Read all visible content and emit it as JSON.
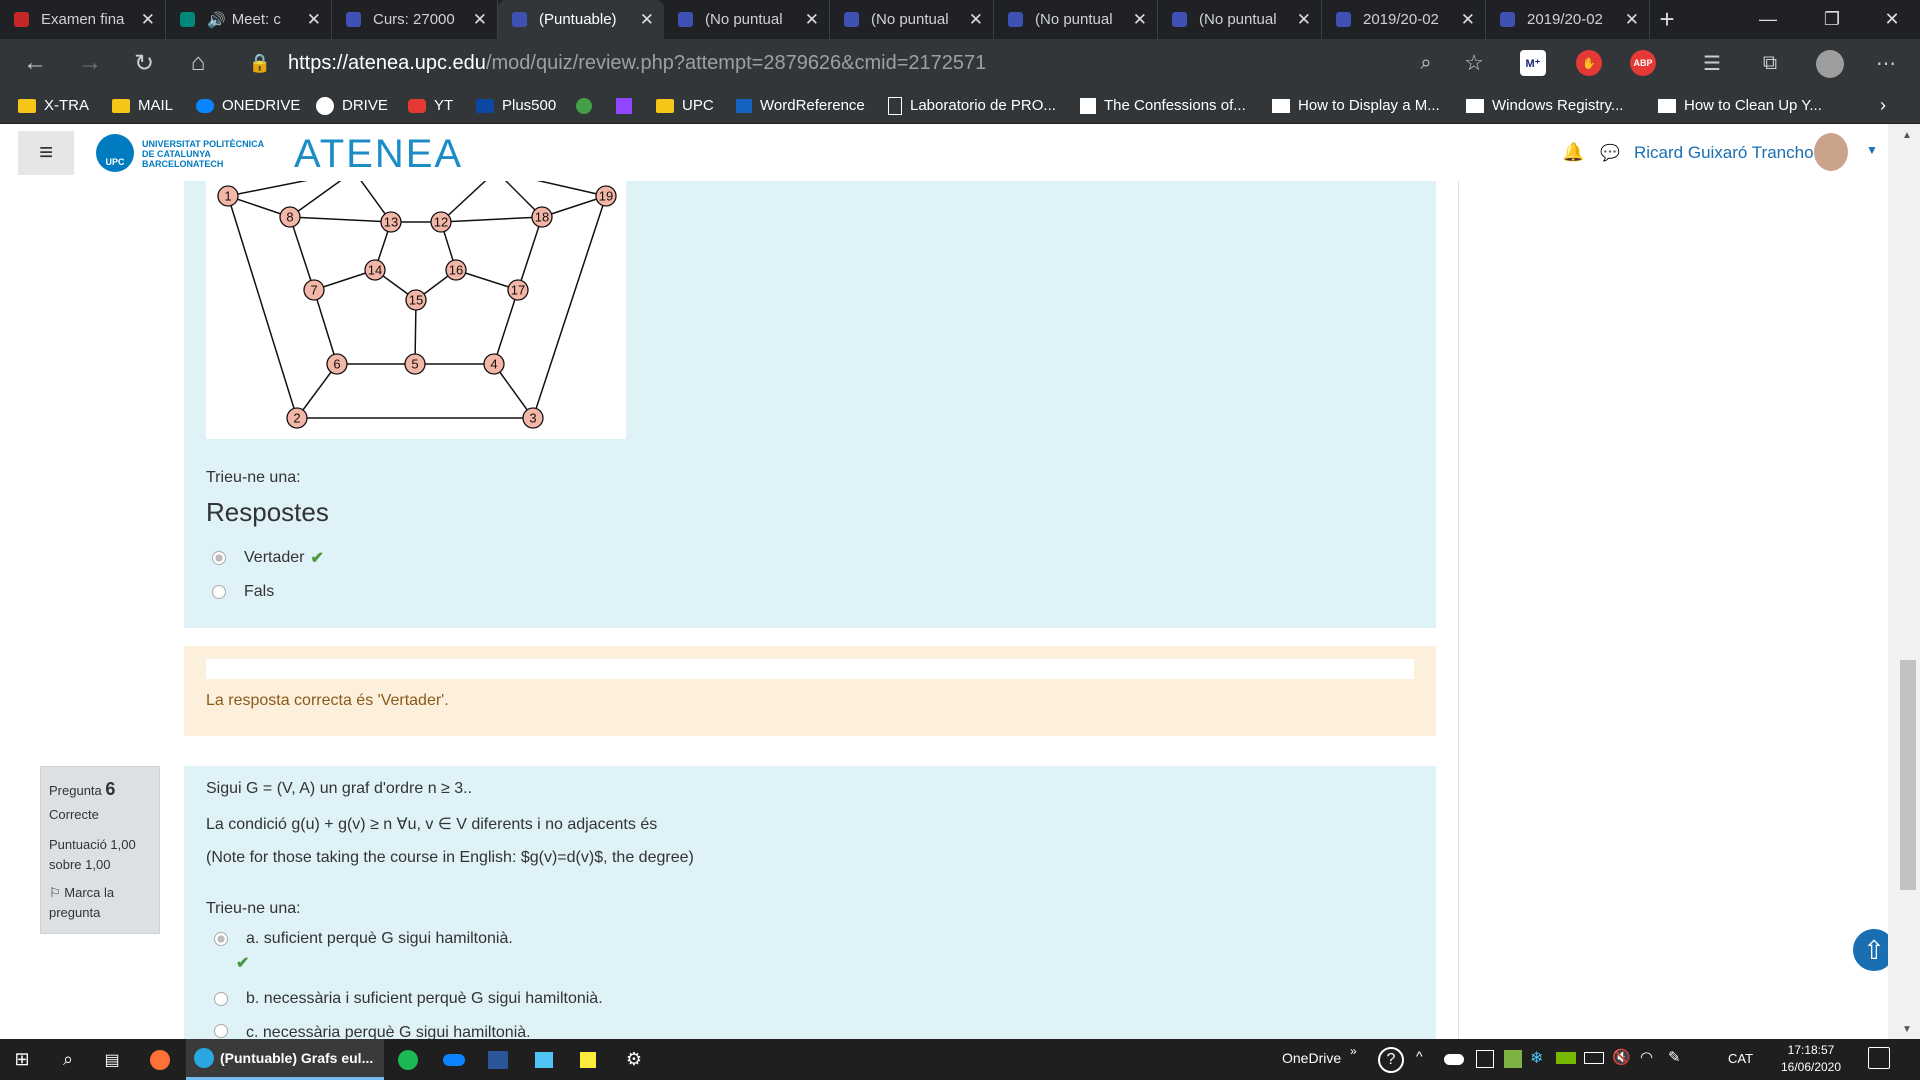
{
  "tabs": [
    {
      "title": "Examen fina",
      "icon": "flag-icon"
    },
    {
      "title": "Meet: c",
      "icon": "meet-icon"
    },
    {
      "title": "Curs: 27000",
      "icon": "moodle-icon"
    },
    {
      "title": "(Puntuable)",
      "icon": "moodle-icon"
    },
    {
      "title": "(No puntual",
      "icon": "moodle-icon"
    },
    {
      "title": "(No puntual",
      "icon": "moodle-icon"
    },
    {
      "title": "(No puntual",
      "icon": "moodle-icon"
    },
    {
      "title": "(No puntual",
      "icon": "moodle-icon"
    },
    {
      "title": "2019/20-02",
      "icon": "moodle-icon"
    },
    {
      "title": "2019/20-02",
      "icon": "moodle-icon"
    }
  ],
  "url": {
    "host": "https://atenea.upc.edu",
    "path": "/mod/quiz/review.php?attempt=2879626&cmid=2172571"
  },
  "bookmarks": [
    "X-TRA",
    "MAIL",
    "ONEDRIVE",
    "DRIVE",
    "YT",
    "Plus500",
    "UPC",
    "WordReference",
    "Laboratorio de PRO...",
    "The Confessions of...",
    "How to Display a M...",
    "Windows Registry...",
    "How to Clean Up Y..."
  ],
  "header": {
    "logo_line1": "UNIVERSITAT POLITÈCNICA",
    "logo_line2": "DE CATALUNYA",
    "logo_line3": "BARCELONATECH",
    "upc": "UPC",
    "site_name": "ATENEA",
    "user_name": "Ricard Guixaró Trancho"
  },
  "question5": {
    "nodes": [
      "1",
      "2",
      "3",
      "4",
      "5",
      "6",
      "7",
      "8",
      "12",
      "13",
      "14",
      "15",
      "16",
      "17",
      "18",
      "19"
    ],
    "prompt": "Trieu-ne una:",
    "answers_heading": "Respostes",
    "options": [
      {
        "label": "Vertader",
        "selected": true,
        "correct": true
      },
      {
        "label": "Fals",
        "selected": false,
        "correct": false
      }
    ],
    "feedback": "La resposta correcta és 'Vertader'."
  },
  "question6": {
    "info_label": "Pregunta",
    "number": "6",
    "state": "Correcte",
    "grade_line1": "Puntuació 1,00",
    "grade_line2": "sobre 1,00",
    "flag_line1": "Marca la",
    "flag_line2": "pregunta",
    "text_line1": "Sigui G = (V, A) un graf d'ordre n ≥ 3..",
    "text_line2": "La condició g(u) + g(v) ≥ n  ∀u, v ∈ V diferents i no adjacents  és",
    "text_line3": "(Note for those taking the course in English: $g(v)=d(v)$, the degree)",
    "prompt": "Trieu-ne una:",
    "options": [
      {
        "label": "a. suficient perquè G sigui hamiltonià.",
        "selected": true
      },
      {
        "label": "b. necessària i suficient perquè G sigui hamiltonià.",
        "selected": false
      },
      {
        "label": "c. necessària perquè G sigui hamiltonià.",
        "selected": false
      }
    ]
  },
  "taskbar": {
    "active_app": "(Puntuable) Grafs eul...",
    "onedrive": "OneDrive",
    "lang": "CAT",
    "time": "17:18:57",
    "date": "16/06/2020"
  }
}
